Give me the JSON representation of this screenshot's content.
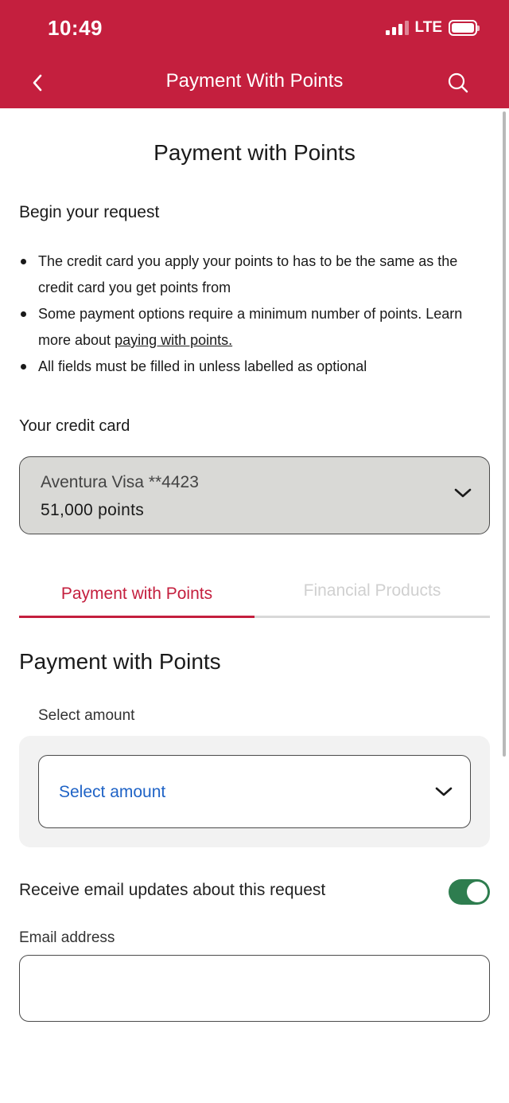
{
  "status_bar": {
    "time": "10:49",
    "network": "LTE"
  },
  "nav": {
    "title": "Payment With Points",
    "back_icon": "chevron-left-icon",
    "search_icon": "search-icon"
  },
  "page": {
    "title": "Payment with Points",
    "intro": "Begin your request",
    "bullets": {
      "b1": "The credit card you apply your points to has to be the same as the credit card you get points from",
      "b2_text": "Some payment options require a minimum number of points. Learn more about ",
      "b2_link": "paying with points.",
      "b3": "All fields must be filled in unless labelled as optional"
    }
  },
  "credit_card": {
    "label": "Your credit card",
    "selected_name": "Aventura Visa **4423",
    "selected_points": "51,000 points"
  },
  "tabs": {
    "active": "Payment with Points",
    "inactive": "Financial Products"
  },
  "payment_section": {
    "title": "Payment with Points",
    "amount_label": "Select amount",
    "amount_placeholder": "Select amount"
  },
  "email": {
    "toggle_label": "Receive email updates about this request",
    "toggle_on": true,
    "address_label": "Email address",
    "address_value": ""
  },
  "colors": {
    "brand_red": "#c41f3e",
    "link_blue": "#1f63c6",
    "toggle_green": "#2e7d4f"
  }
}
